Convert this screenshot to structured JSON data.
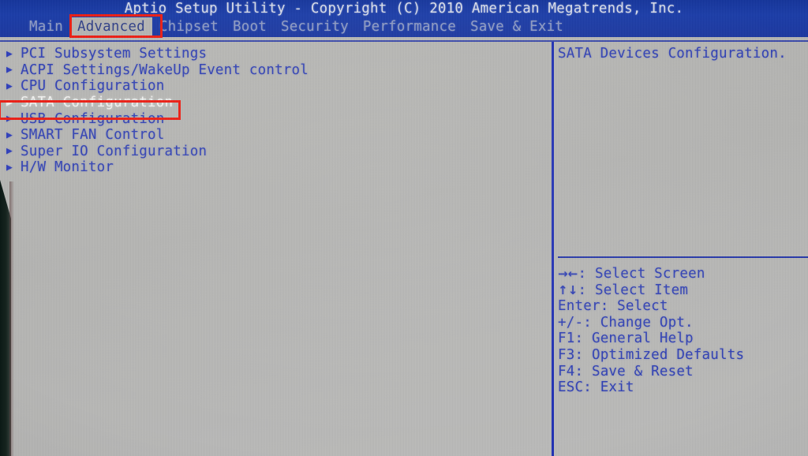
{
  "header": {
    "title": "Aptio Setup Utility - Copyright (C) 2010 American Megatrends, Inc.",
    "tabs": [
      {
        "label": "Main",
        "active": false
      },
      {
        "label": "Advanced",
        "active": true
      },
      {
        "label": "Chipset",
        "active": false
      },
      {
        "label": "Boot",
        "active": false
      },
      {
        "label": "Security",
        "active": false
      },
      {
        "label": "Performance",
        "active": false
      },
      {
        "label": "Save & Exit",
        "active": false
      }
    ]
  },
  "left_pane": {
    "marker_glyph": "▶",
    "items": [
      {
        "label": "PCI Subsystem Settings",
        "selected": false
      },
      {
        "label": "ACPI Settings/WakeUp Event control",
        "selected": false
      },
      {
        "label": "CPU Configuration",
        "selected": false
      },
      {
        "label": "SATA Configuration",
        "selected": true
      },
      {
        "label": "USB Configuration",
        "selected": false
      },
      {
        "label": "SMART FAN Control",
        "selected": false
      },
      {
        "label": "Super IO Configuration",
        "selected": false
      },
      {
        "label": "H/W Monitor",
        "selected": false
      }
    ]
  },
  "right_pane": {
    "help_text": "SATA Devices Configuration.",
    "keys": [
      {
        "glyph": "→←",
        "key": "",
        "label": ": Select Screen"
      },
      {
        "glyph": "↑↓",
        "key": "",
        "label": ": Select Item"
      },
      {
        "glyph": "",
        "key": "Enter",
        "label": ": Select"
      },
      {
        "glyph": "",
        "key": "+/-",
        "label": ": Change Opt."
      },
      {
        "glyph": "",
        "key": "F1",
        "label": ": General Help"
      },
      {
        "glyph": "",
        "key": "F3",
        "label": ": Optimized Defaults"
      },
      {
        "glyph": "",
        "key": "F4",
        "label": ": Save & Reset"
      },
      {
        "glyph": "",
        "key": "ESC",
        "label": ": Exit"
      }
    ]
  },
  "annotations": [
    {
      "name": "advanced-tab-highlight",
      "color": "#ec1c12"
    },
    {
      "name": "sata-configuration-highlight",
      "color": "#ec1c12"
    }
  ]
}
